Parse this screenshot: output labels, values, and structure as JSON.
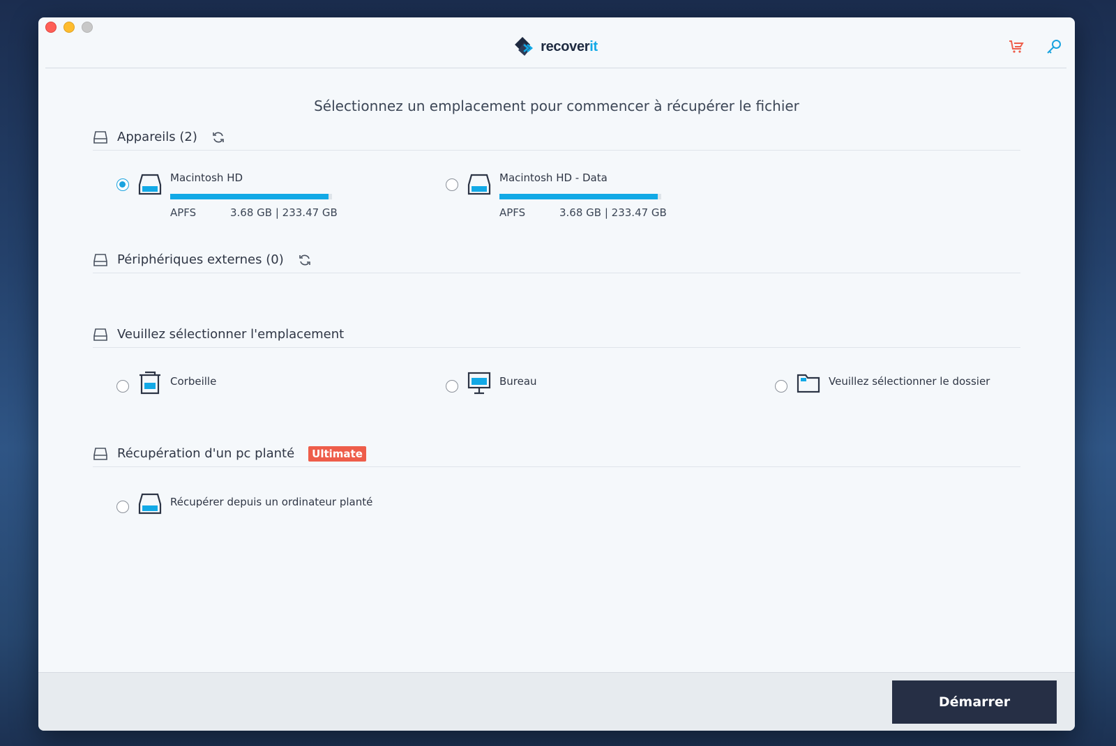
{
  "app": {
    "logo_main": "recover",
    "logo_accent": "it"
  },
  "header": {
    "cart_icon": "cart-icon",
    "key_icon": "key-icon",
    "cart_color": "#ee5d4a",
    "key_color": "#1aa3df"
  },
  "page": {
    "title": "Sélectionnez un emplacement pour commencer à récupérer le fichier"
  },
  "devices": {
    "title": "Appareils (2)",
    "items": [
      {
        "name": "Macintosh HD",
        "fs": "APFS",
        "size": "3.68 GB | 233.47 GB",
        "usage": 0.98,
        "selected": true
      },
      {
        "name": "Macintosh HD - Data",
        "fs": "APFS",
        "size": "3.68 GB | 233.47 GB",
        "usage": 0.98,
        "selected": false
      }
    ]
  },
  "external": {
    "title": "Périphériques externes (0)"
  },
  "location": {
    "title": "Veuillez sélectionner l'emplacement",
    "items": [
      {
        "label": "Corbeille",
        "icon": "trash-icon"
      },
      {
        "label": "Bureau",
        "icon": "desktop-icon"
      },
      {
        "label": "Veuillez sélectionner le dossier",
        "icon": "folder-icon"
      }
    ]
  },
  "crash": {
    "title": "Récupération d'un pc planté",
    "badge": "Ultimate",
    "items": [
      {
        "label": "Récupérer depuis un ordinateur planté",
        "icon": "drive-icon"
      }
    ]
  },
  "footer": {
    "start_label": "Démarrer"
  },
  "colors": {
    "accent": "#12a9e6",
    "badge": "#ee5d4a",
    "button": "#262f45"
  }
}
